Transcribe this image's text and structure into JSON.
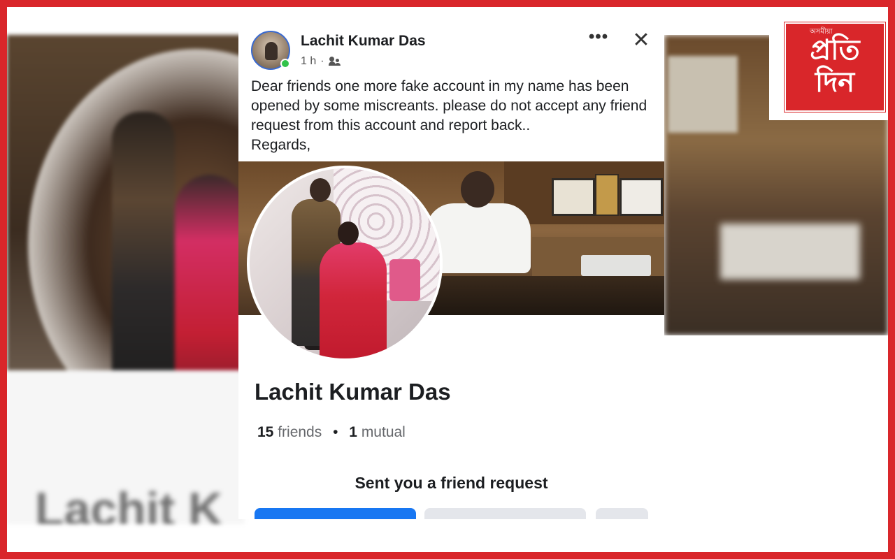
{
  "post": {
    "author": "Lachit Kumar Das",
    "time": "1 h",
    "separator": "·",
    "audience_icon": "friends-icon",
    "more_label": "•••",
    "close_label": "✕",
    "text": "Dear friends one more fake account in my name has been opened by some miscreants.  please do not accept any  friend request from this account and report back..\nRegards,"
  },
  "profile": {
    "name": "Lachit Kumar Das",
    "friends_count": "15",
    "friends_label": "friends",
    "mutual_count": "1",
    "mutual_label": "mutual",
    "bullet": "•",
    "request_text": "Sent you a friend request"
  },
  "background": {
    "ghost_name": "Lachit K"
  },
  "logo": {
    "small_text": "অসমীয়া",
    "line1": "প্রতি",
    "line2": "দিন"
  },
  "colors": {
    "frame": "#d9262a",
    "confirm_button": "#1877f2",
    "secondary_button": "#e4e6eb",
    "online": "#31c24a"
  }
}
